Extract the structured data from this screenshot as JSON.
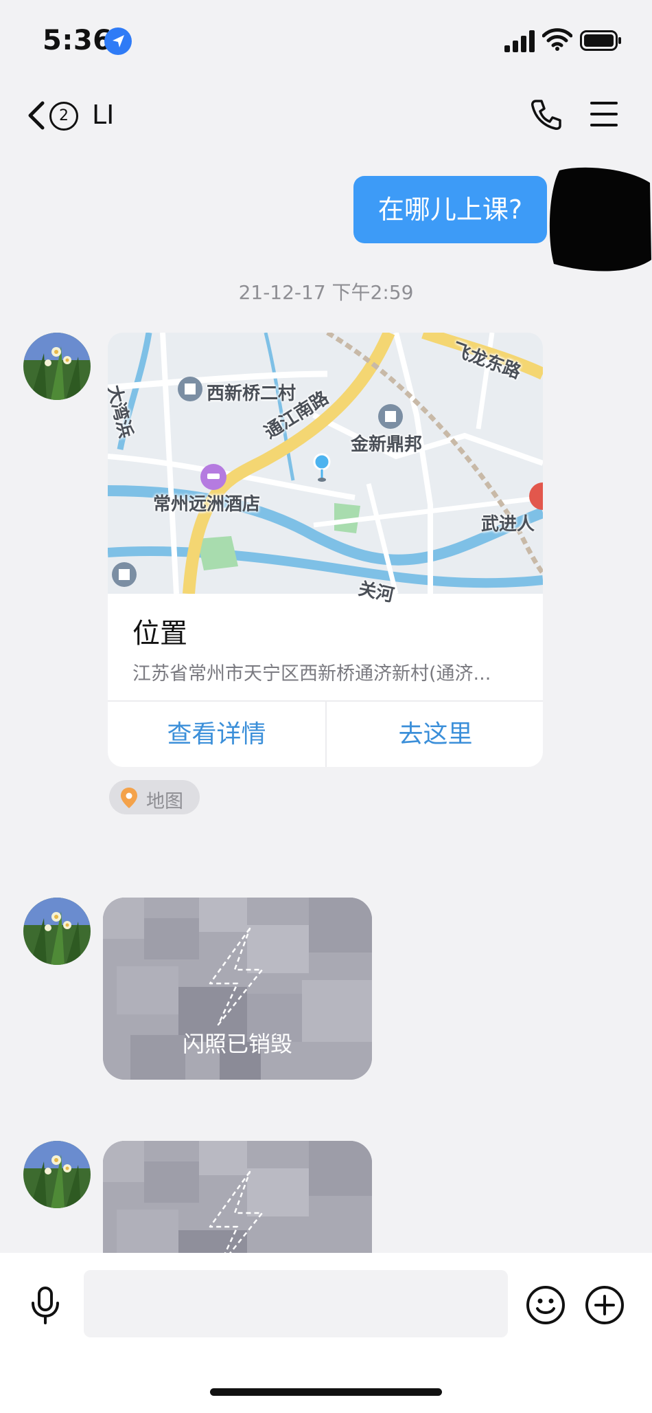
{
  "status": {
    "time": "5:36"
  },
  "nav": {
    "badge": "2",
    "title": "LI"
  },
  "messages": {
    "outgoing_text": "在哪儿上课?",
    "timestamp": "21-12-17 下午2:59",
    "location": {
      "title": "位置",
      "address": "江苏省常州市天宁区西新桥通济新村(通济...",
      "view_details": "查看详情",
      "go_here": "去这里",
      "map_tag": "地图",
      "map_labels": [
        "西新桥二村",
        "通江南路",
        "金新鼎邦",
        "飞龙东路",
        "大湾浜",
        "常州远洲酒店",
        "武进人",
        "关河"
      ]
    },
    "flash_photo_label": "闪照已销毁"
  },
  "input": {
    "placeholder": ""
  },
  "colors": {
    "accent": "#3d9bf7",
    "link": "#3b8fd9",
    "background": "#f2f2f4",
    "flash_tile": "#a7a7b1"
  }
}
